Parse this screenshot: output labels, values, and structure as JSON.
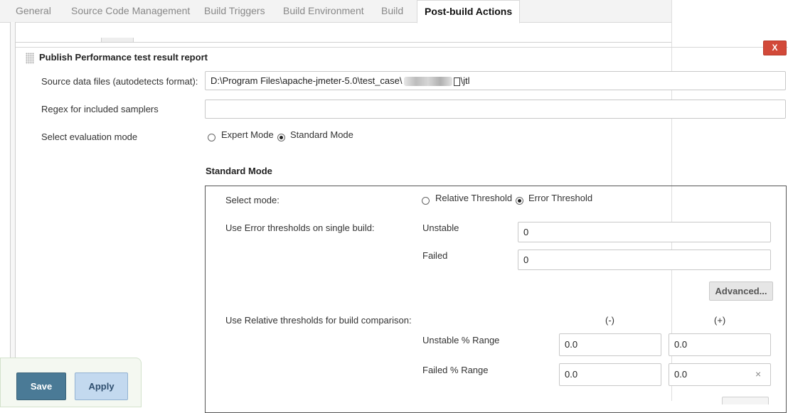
{
  "tabs": [
    {
      "label": "General",
      "active": false
    },
    {
      "label": "Source Code Management",
      "active": false
    },
    {
      "label": "Build Triggers",
      "active": false
    },
    {
      "label": "Build Environment",
      "active": false
    },
    {
      "label": "Build",
      "active": false
    },
    {
      "label": "Post-build Actions",
      "active": true
    }
  ],
  "section": {
    "title": "Publish Performance test result report",
    "close_label": "X"
  },
  "form": {
    "source_label": "Source data files (autodetects format):",
    "source_value_prefix": "D:\\Program Files\\apache-jmeter-5.0\\test_case\\",
    "source_value_suffix": "\\jtl",
    "regex_label": "Regex for included samplers",
    "regex_value": "",
    "eval_mode_label": "Select evaluation mode",
    "expert_mode_label": "Expert Mode",
    "standard_mode_label": "Standard Mode",
    "selected_eval_mode": "Standard Mode"
  },
  "standard": {
    "heading": "Standard Mode",
    "select_mode_label": "Select mode:",
    "relative_threshold_label": "Relative Threshold",
    "error_threshold_label": "Error Threshold",
    "selected_mode": "Error Threshold",
    "error_single_label": "Use Error thresholds on single build:",
    "unstable_label": "Unstable",
    "unstable_value": "0",
    "failed_label": "Failed",
    "failed_value": "0",
    "advanced_label": "Advanced...",
    "relative_label": "Use Relative thresholds for build comparison:",
    "minus_header": "(-)",
    "plus_header": "(+)",
    "unstable_range_label": "Unstable % Range",
    "unstable_range_minus": "0.0",
    "unstable_range_plus": "0.0",
    "failed_range_label": "Failed % Range",
    "failed_range_minus": "0.0",
    "failed_range_plus": "0.0",
    "clear_glyph": "×"
  },
  "footer": {
    "save_label": "Save",
    "apply_label": "Apply"
  }
}
